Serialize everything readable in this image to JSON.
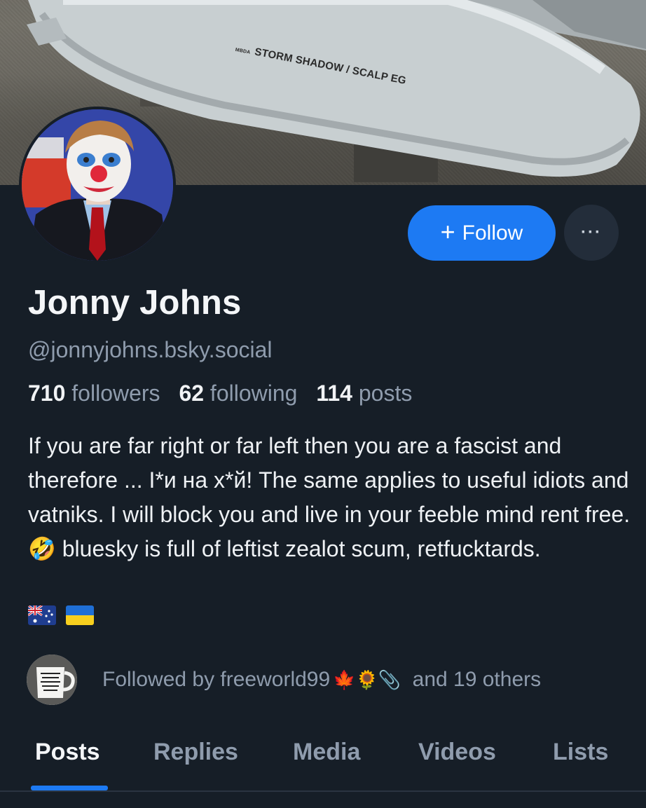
{
  "banner": {
    "missile_label": "STORM SHADOW / SCALP EG",
    "missile_small_label": "MBDA"
  },
  "profile": {
    "display_name": "Jonny Johns",
    "handle": "@jonnyjohns.bsky.social",
    "followers_count": "710",
    "followers_label": "followers",
    "following_count": "62",
    "following_label": "following",
    "posts_count": "114",
    "posts_label": "posts",
    "bio": "If you are far right or far left then you are a fascist and therefore ... I*и на х*й! The same applies to useful idiots and vatniks. I will block you and live in your feeble mind rent free. 🤣 bluesky is full of leftist zealot scum, retfucktards.",
    "flags": [
      "australia-flag",
      "ukraine-flag"
    ]
  },
  "actions": {
    "follow_label": "Follow",
    "follow_icon": "+",
    "more_label": "···"
  },
  "followed_by": {
    "prefix": "Followed by freeworld99",
    "emojis": "🍁🌻📎",
    "suffix": "and 19 others",
    "mug_text": "SCIENCE DOESN'T GIVE A FUCK WHAT YOU BELIEVE"
  },
  "tabs": [
    "Posts",
    "Replies",
    "Media",
    "Videos",
    "Lists"
  ],
  "active_tab": "Posts",
  "colors": {
    "background": "#161e27",
    "accent": "#1d7af3",
    "muted_text": "#8f9cad",
    "text": "#f1f3f5"
  }
}
